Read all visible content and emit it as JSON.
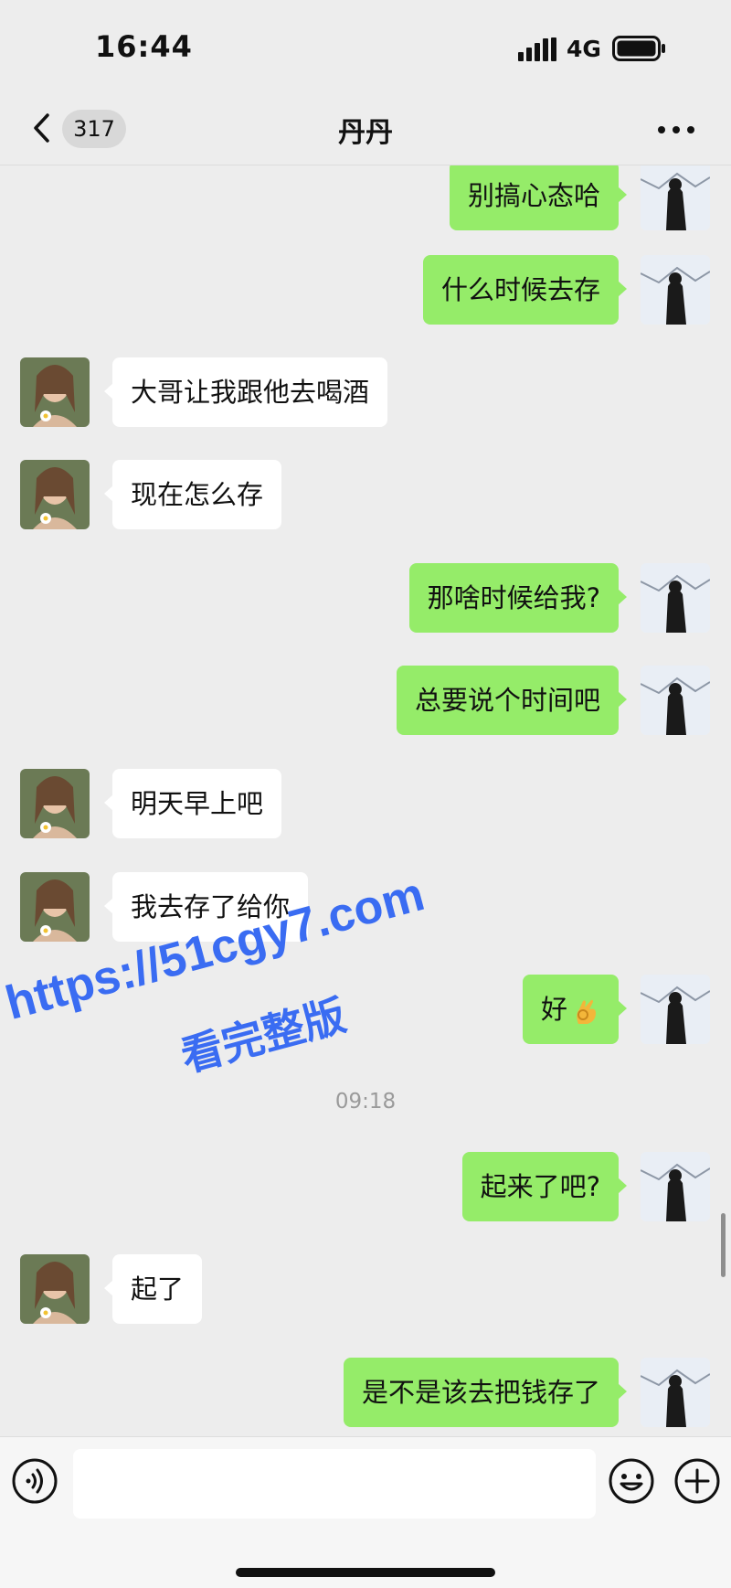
{
  "status_bar": {
    "time": "16:44",
    "network": "4G",
    "icons": [
      "signal-icon",
      "battery-icon"
    ]
  },
  "nav": {
    "back_icon": "chevron-left-icon",
    "unread_count": "317",
    "title": "丹丹",
    "more_icon": "more-dots-icon"
  },
  "messages": [
    {
      "side": "right",
      "text": "别搞心态哈"
    },
    {
      "side": "right",
      "text": "什么时候去存"
    },
    {
      "side": "left",
      "text": "大哥让我跟他去喝酒"
    },
    {
      "side": "left",
      "text": "现在怎么存"
    },
    {
      "side": "right",
      "text": "那啥时候给我?"
    },
    {
      "side": "right",
      "text": "总要说个时间吧"
    },
    {
      "side": "left",
      "text": "明天早上吧"
    },
    {
      "side": "left",
      "text": "我去存了给你"
    },
    {
      "side": "right",
      "text": "好",
      "emoji": "ok-hand-emoji"
    },
    {
      "side": "right",
      "text": "起来了吧?"
    },
    {
      "side": "left",
      "text": "起了"
    },
    {
      "side": "right",
      "text": "是不是该去把钱存了"
    }
  ],
  "time_separator": "09:18",
  "watermark": {
    "line1": "https://51cgy7.com",
    "line2": "看完整版"
  },
  "input_bar": {
    "placeholder": "",
    "icons": [
      "voice-icon",
      "emoji-icon",
      "plus-icon"
    ]
  },
  "colors": {
    "background": "#ededed",
    "outgoing_bubble": "#95ec69",
    "incoming_bubble": "#ffffff",
    "watermark": "#3a6cf2"
  }
}
